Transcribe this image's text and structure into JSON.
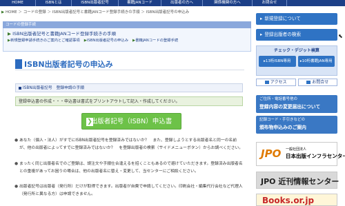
{
  "topnav": [
    "HOME",
    "ISBNとは",
    "ISBN出版者記号",
    "書籍JANコード",
    "出版者の方へ",
    "関係機関の方へ",
    "お問合せ"
  ],
  "breadcrumb": [
    "HOME",
    "コードの登録",
    "ISBN出版者記号と書籍JANコード登録手続きの手順",
    "ISBN出版者記号の申込み"
  ],
  "panel": {
    "title": "コードの登録手続",
    "line1": "ISBN出版者記号と書籍JANコード登録手続きの手順",
    "links": [
      "新規登録申請手続きのご案内とご確認事項",
      "ISBN出版者記号の申込み",
      "書籍JANコードの登録手続"
    ]
  },
  "page_title": "ISBN出版者記号の申込み",
  "step_label": "ISBN出版者記号　登録申請の手順",
  "note": "登録申込書の作成・・・申込書は書式をプリントアウトして記入・作成してください。",
  "apply_button": "出版者記号（ISBN）申込書",
  "paragraphs": [
    "あなた（個人・法人）がすでにISBN出版者記号を登録済みではないか？　また、登録しようとする出版者名と同一の名前が、他の出版者によってすでに登録済みではないか？　を登録出版者の検索（サイドメニューボタン）からお調べください。",
    "まったく同じ出版者名でのご登録は、誤注文や手順仕合違えるを招くこともあるので避けていただきます。登録済み出版者名との重複があってお困りの場合は、他の出版者名に替え・変更して、当センターにご相談ください。",
    "出版者記号は出版者（発行所）だけが取得できます。出版者が自費で申請してください。印刷会社・編集代行会社など代理人（発行所と異なる方）は申請できません。"
  ],
  "side": {
    "new_registration": "新規登録について",
    "search_publisher": "登録出版者の検索",
    "check_title": "チェック・デジット検算",
    "isbn13": "13桁ISBN専用",
    "isbn10": "10桁書籍JAN専用",
    "access": "アクセス",
    "contact": "お問合せ",
    "change_small": "ご住所・電話番号他の",
    "change_big": "登録内容の変更届出について",
    "record_small": "記録コード・手引きなどの",
    "record_big": "頒布物申込みのご案内",
    "jpo_logo": "JPO",
    "jpo_t1": "一般社団法人",
    "jpo_t2": "日本出版インフラセンター",
    "jpo2": "JPO 近刊情報センター",
    "books": "Books.or.jp"
  }
}
